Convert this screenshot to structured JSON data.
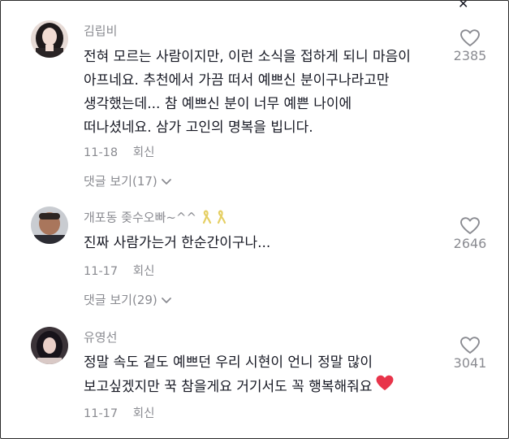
{
  "comments": [
    {
      "author": "김립비",
      "lines": [
        "전혀 모르는 사람이지만, 이런 소식을 접하게 되니 마음이",
        "아프네요. 추천에서 가끔 떠서 예쁘신 분이구나라고만",
        "생각했는데... 참 예쁘신 분이 너무 예쁜 나이에",
        "떠나셨네요. 삼가 고인의 명복을 빕니다."
      ],
      "date": "11-18",
      "reply_label": "회신",
      "view_replies": "댓글 보기(17)",
      "likes": "2385"
    },
    {
      "author": "개포동 좆수오빠~^^",
      "lines": [
        "진짜 사람가는거 한순간이구나..."
      ],
      "date": "11-17",
      "reply_label": "회신",
      "view_replies": "댓글 보기(29)",
      "likes": "2646"
    },
    {
      "author": "유영선",
      "lines": [
        "정말 속도 겉도 예쁘던 우리 시현이 언니 정말 많이",
        "보고싶겠지만 꾹 참을게요 거기서도 꼭 행복해줘요"
      ],
      "date": "11-17",
      "reply_label": "회신",
      "likes": "3041"
    }
  ],
  "colors": {
    "text": "#161823",
    "muted": "#8a8b91",
    "heart_red": "#e8344a",
    "ribbon_yellow": "#f1dc7c"
  },
  "icons": {
    "like": "heart-outline-icon",
    "expand": "chevron-down-icon",
    "ribbon": "yellow-ribbon-icon",
    "emoji": "red-heart-emoji"
  }
}
